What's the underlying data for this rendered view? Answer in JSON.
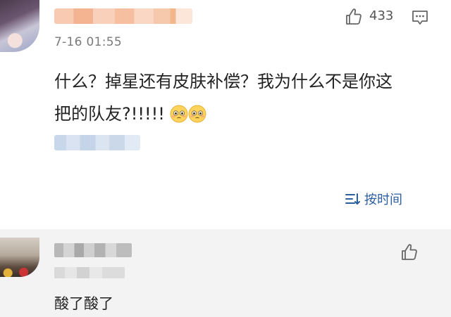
{
  "comment": {
    "timestamp": "7-16 01:55",
    "like_count": "433",
    "text": "什么？掉星还有皮肤补偿？我为什么不是你这\n把的队友?!!!!! ",
    "emoji": "flushed-face-emoji"
  },
  "sort": {
    "label": "按时间"
  },
  "reply": {
    "text": "酸了酸了"
  },
  "colors": {
    "link_blue": "#2b5e9c",
    "reply_bg": "#f3f3f3",
    "meta_gray": "#7a7a7a"
  }
}
